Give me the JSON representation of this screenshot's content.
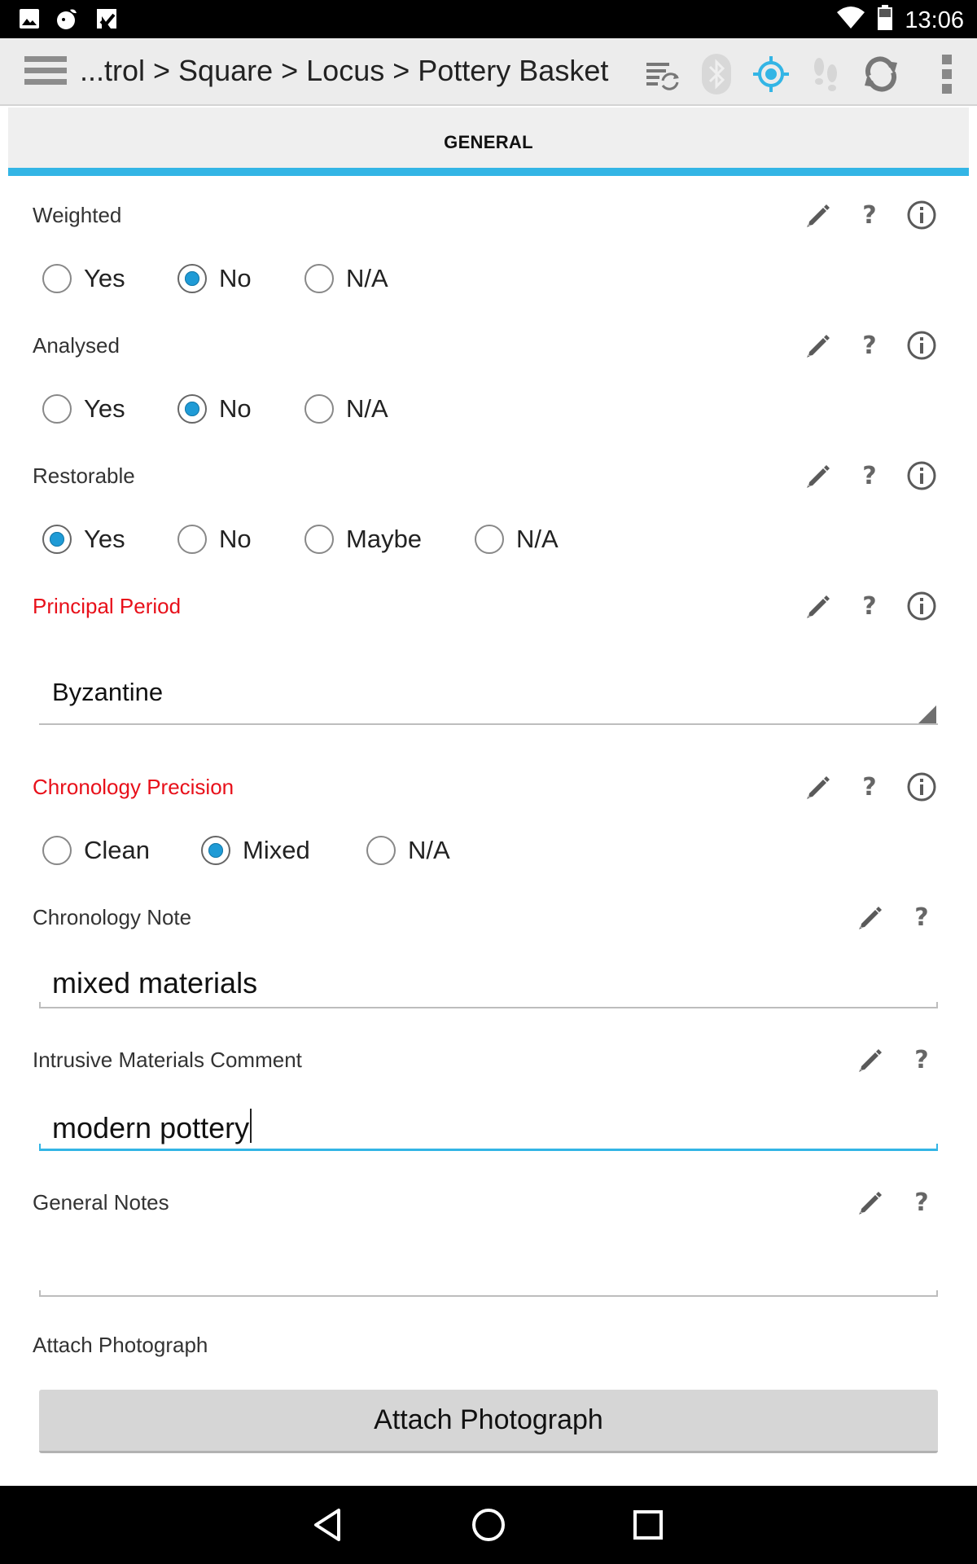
{
  "status_bar": {
    "time": "13:06",
    "left_icons": [
      "image-icon",
      "notification-app-icon",
      "check-flag-icon"
    ],
    "right_icons": [
      "wifi-icon",
      "battery-icon"
    ]
  },
  "app_bar": {
    "breadcrumb": "...trol > Square > Locus > Pottery Basket",
    "icons": [
      "sync-list-icon",
      "bluetooth-icon",
      "gps-icon",
      "footsteps-icon",
      "refresh-icon",
      "overflow-menu-icon"
    ],
    "colors": {
      "gps_active": "#33b5e5",
      "inactive": "#bdbdbd"
    }
  },
  "tabs": [
    {
      "label": "GENERAL",
      "active": true
    }
  ],
  "fields": {
    "weighted": {
      "label": "Weighted",
      "required": false,
      "options": [
        "Yes",
        "No",
        "N/A"
      ],
      "selected": "No"
    },
    "analysed": {
      "label": "Analysed",
      "required": false,
      "options": [
        "Yes",
        "No",
        "N/A"
      ],
      "selected": "No"
    },
    "restorable": {
      "label": "Restorable",
      "required": false,
      "options": [
        "Yes",
        "No",
        "Maybe",
        "N/A"
      ],
      "selected": "Yes"
    },
    "principal_period": {
      "label": "Principal Period",
      "required": true,
      "value": "Byzantine"
    },
    "chronology_precision": {
      "label": "Chronology Precision",
      "required": true,
      "options": [
        "Clean",
        "Mixed",
        "N/A"
      ],
      "selected": "Mixed"
    },
    "chronology_note": {
      "label": "Chronology Note",
      "value": "mixed materials"
    },
    "intrusive_materials_comment": {
      "label": "Intrusive Materials Comment",
      "value": "modern pottery",
      "focused": true
    },
    "general_notes": {
      "label": "General Notes",
      "value": ""
    },
    "attach_photograph": {
      "label": "Attach Photograph",
      "button_label": "Attach Photograph"
    }
  },
  "colors": {
    "accent": "#33b5e5",
    "required_label": "#e8101a",
    "radio_selected": "#1f9bd6"
  },
  "nav_bar": {
    "icons": [
      "back-icon",
      "home-icon",
      "recents-icon"
    ]
  }
}
